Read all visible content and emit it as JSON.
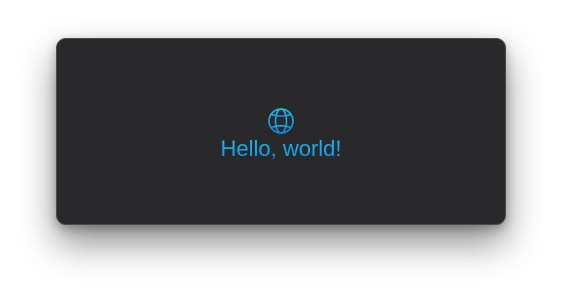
{
  "window": {
    "background_color": "#29292b"
  },
  "content": {
    "icon": "globe-icon",
    "greeting": "Hello, world!",
    "accent_color": "#14a6e8"
  }
}
